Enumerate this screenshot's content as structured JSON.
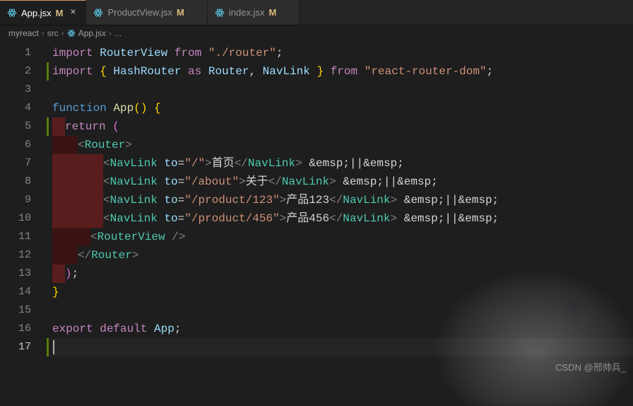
{
  "tabs": [
    {
      "label": "App.jsx",
      "modified": "M",
      "active": true
    },
    {
      "label": "ProductView.jsx",
      "modified": "M",
      "active": false
    },
    {
      "label": "index.jsx",
      "modified": "M",
      "active": false
    }
  ],
  "breadcrumb": {
    "p0": "myreact",
    "p1": "src",
    "p2": "App.jsx",
    "p3": "..."
  },
  "gutter": [
    "1",
    "2",
    "3",
    "4",
    "5",
    "6",
    "7",
    "8",
    "9",
    "10",
    "11",
    "12",
    "13",
    "14",
    "15",
    "16",
    "17"
  ],
  "code": {
    "l1": {
      "a": "import",
      "b": "RouterView",
      "c": "from",
      "d": "\"./router\"",
      "e": ";"
    },
    "l2": {
      "a": "import",
      "b": "{ ",
      "c": "HashRouter",
      "d": "as",
      "e": "Router",
      "f": ", ",
      "g": "NavLink",
      "h": " }",
      "i": "from",
      "j": "\"react-router-dom\"",
      "k": ";"
    },
    "l4": {
      "a": "function",
      "b": "App",
      "c": "()",
      "d": "{"
    },
    "l5": {
      "a": "return",
      "b": "("
    },
    "l6": {
      "open": "<",
      "tag": "Router",
      "close": ">"
    },
    "l7": {
      "open": "<",
      "tag": "NavLink",
      "attr": "to",
      "eq": "=",
      "val": "\"/\"",
      "gt": ">",
      "text": "首页",
      "co": "</",
      "ctag": "NavLink",
      "cgt": ">",
      "ent": " &emsp;||&emsp;"
    },
    "l8": {
      "open": "<",
      "tag": "NavLink",
      "attr": "to",
      "eq": "=",
      "val": "\"/about\"",
      "gt": ">",
      "text": "关于",
      "co": "</",
      "ctag": "NavLink",
      "cgt": ">",
      "ent": " &emsp;||&emsp;"
    },
    "l9": {
      "open": "<",
      "tag": "NavLink",
      "attr": "to",
      "eq": "=",
      "val": "\"/product/123\"",
      "gt": ">",
      "text": "产品123",
      "co": "</",
      "ctag": "NavLink",
      "cgt": ">",
      "ent": " &emsp;||&emsp;"
    },
    "l10": {
      "open": "<",
      "tag": "NavLink",
      "attr": "to",
      "eq": "=",
      "val": "\"/product/456\"",
      "gt": ">",
      "text": "产品456",
      "co": "</",
      "ctag": "NavLink",
      "cgt": ">",
      "ent": " &emsp;||&emsp;"
    },
    "l11": {
      "open": "<",
      "tag": "RouterView",
      "self": " />"
    },
    "l12": {
      "co": "</",
      "tag": "Router",
      "cgt": ">"
    },
    "l13": {
      "a": ")",
      "b": ";"
    },
    "l14": {
      "a": "}"
    },
    "l16": {
      "a": "export",
      "b": "default",
      "c": "App",
      "d": ";"
    }
  },
  "watermark": "CSDN @邢帅兵_"
}
